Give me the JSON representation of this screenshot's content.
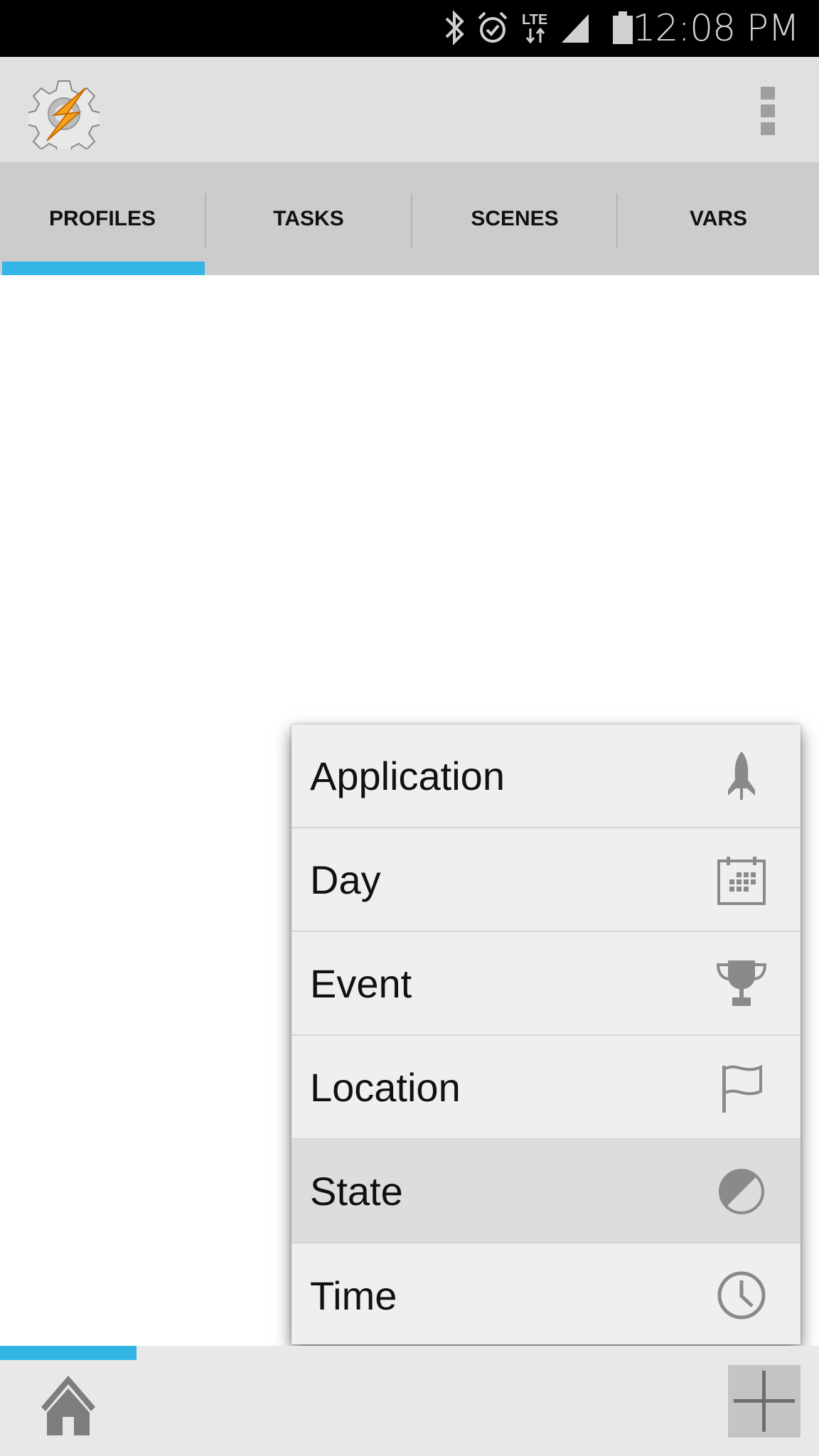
{
  "status_bar": {
    "time": "12:08 PM",
    "icons": [
      "bluetooth-icon",
      "alarm-icon",
      "lte-icon",
      "signal-icon",
      "battery-icon"
    ]
  },
  "toolbar": {
    "logo": "tasker-gear-bolt-logo",
    "overflow_icon": "more-vert-icon"
  },
  "tabs": [
    {
      "label": "PROFILES",
      "selected": true
    },
    {
      "label": "TASKS",
      "selected": false
    },
    {
      "label": "SCENES",
      "selected": false
    },
    {
      "label": "VARS",
      "selected": false
    }
  ],
  "accent_color": "#33b5e5",
  "context_menu": {
    "items": [
      {
        "label": "Application",
        "icon": "rocket-icon"
      },
      {
        "label": "Day",
        "icon": "calendar-icon"
      },
      {
        "label": "Event",
        "icon": "trophy-icon"
      },
      {
        "label": "Location",
        "icon": "flag-icon"
      },
      {
        "label": "State",
        "icon": "half-circle-icon",
        "highlighted": true
      },
      {
        "label": "Time",
        "icon": "clock-icon"
      }
    ]
  },
  "bottom_bar": {
    "home_icon": "home-icon",
    "add_icon": "plus-icon"
  }
}
